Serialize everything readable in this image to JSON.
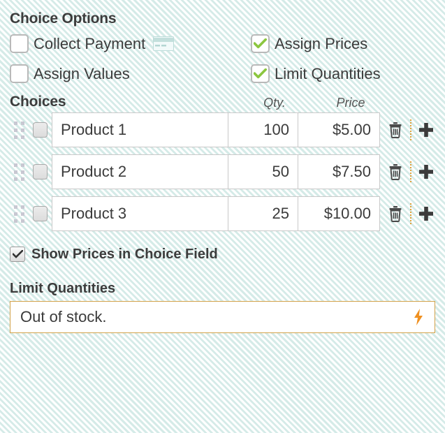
{
  "choice_options": {
    "title": "Choice Options",
    "items": [
      {
        "label": "Collect Payment",
        "checked": false,
        "icon": "credit-card-icon"
      },
      {
        "label": "Assign Prices",
        "checked": true,
        "icon": ""
      },
      {
        "label": "Assign Values",
        "checked": false,
        "icon": ""
      },
      {
        "label": "Limit Quantities",
        "checked": true,
        "icon": ""
      }
    ]
  },
  "choices": {
    "title": "Choices",
    "columns": {
      "qty": "Qty.",
      "price": "Price"
    },
    "rows": [
      {
        "name": "Product 1",
        "qty": "100",
        "price": "$5.00",
        "selected": false
      },
      {
        "name": "Product 2",
        "qty": "50",
        "price": "$7.50",
        "selected": false
      },
      {
        "name": "Product 3",
        "qty": "25",
        "price": "$10.00",
        "selected": false
      }
    ],
    "row_actions": {
      "delete": "delete-choice",
      "add": "add-choice"
    }
  },
  "show_prices": {
    "label": "Show Prices in Choice Field",
    "checked": true
  },
  "limit_quantities": {
    "label": "Limit Quantities",
    "value": "Out of stock.",
    "placeholder": "",
    "merge_tag_icon": "lightning-bolt-icon"
  },
  "colors": {
    "background": "#e3f3f1",
    "stripe": "#d5ebe8",
    "check_green": "#8cc63f",
    "accent_orange": "#e8a33d",
    "text": "#3b3b3b",
    "field_border": "#c9c9c9",
    "merge_border": "#d2a24a"
  }
}
